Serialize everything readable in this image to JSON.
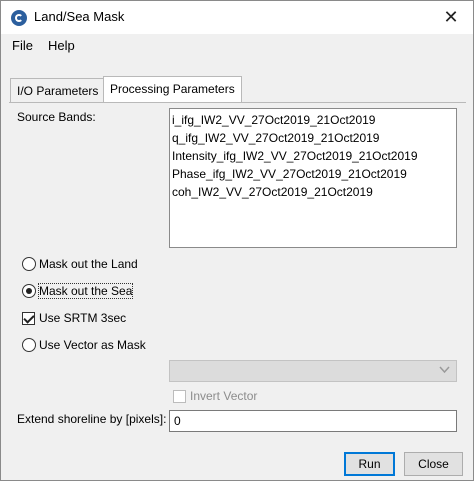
{
  "window": {
    "title": "Land/Sea Mask",
    "close_glyph": "✕"
  },
  "menu": {
    "file": "File",
    "help": "Help"
  },
  "tabs": [
    {
      "label": "I/O Parameters",
      "active": false
    },
    {
      "label": "Processing Parameters",
      "active": true
    }
  ],
  "source_bands": {
    "label": "Source Bands:",
    "items": [
      "i_ifg_IW2_VV_27Oct2019_21Oct2019",
      "q_ifg_IW2_VV_27Oct2019_21Oct2019",
      "Intensity_ifg_IW2_VV_27Oct2019_21Oct2019",
      "Phase_ifg_IW2_VV_27Oct2019_21Oct2019",
      "coh_IW2_VV_27Oct2019_21Oct2019"
    ]
  },
  "options": {
    "mask_land": {
      "label": "Mask out the Land",
      "selected": false
    },
    "mask_sea": {
      "label": "Mask out the Sea",
      "selected": true
    },
    "use_srtm": {
      "label": "Use SRTM 3sec",
      "checked": true
    },
    "use_vector": {
      "label": "Use Vector as Mask",
      "selected": false
    },
    "vector_select_value": "",
    "invert_vector": {
      "label": "Invert Vector",
      "checked": false,
      "enabled": false
    }
  },
  "shoreline": {
    "label": "Extend shoreline by [pixels]:",
    "value": "0"
  },
  "buttons": {
    "run": "Run",
    "close": "Close"
  },
  "icons": {
    "app": "snap-app-icon",
    "dropdown": "chevron-down-icon"
  }
}
